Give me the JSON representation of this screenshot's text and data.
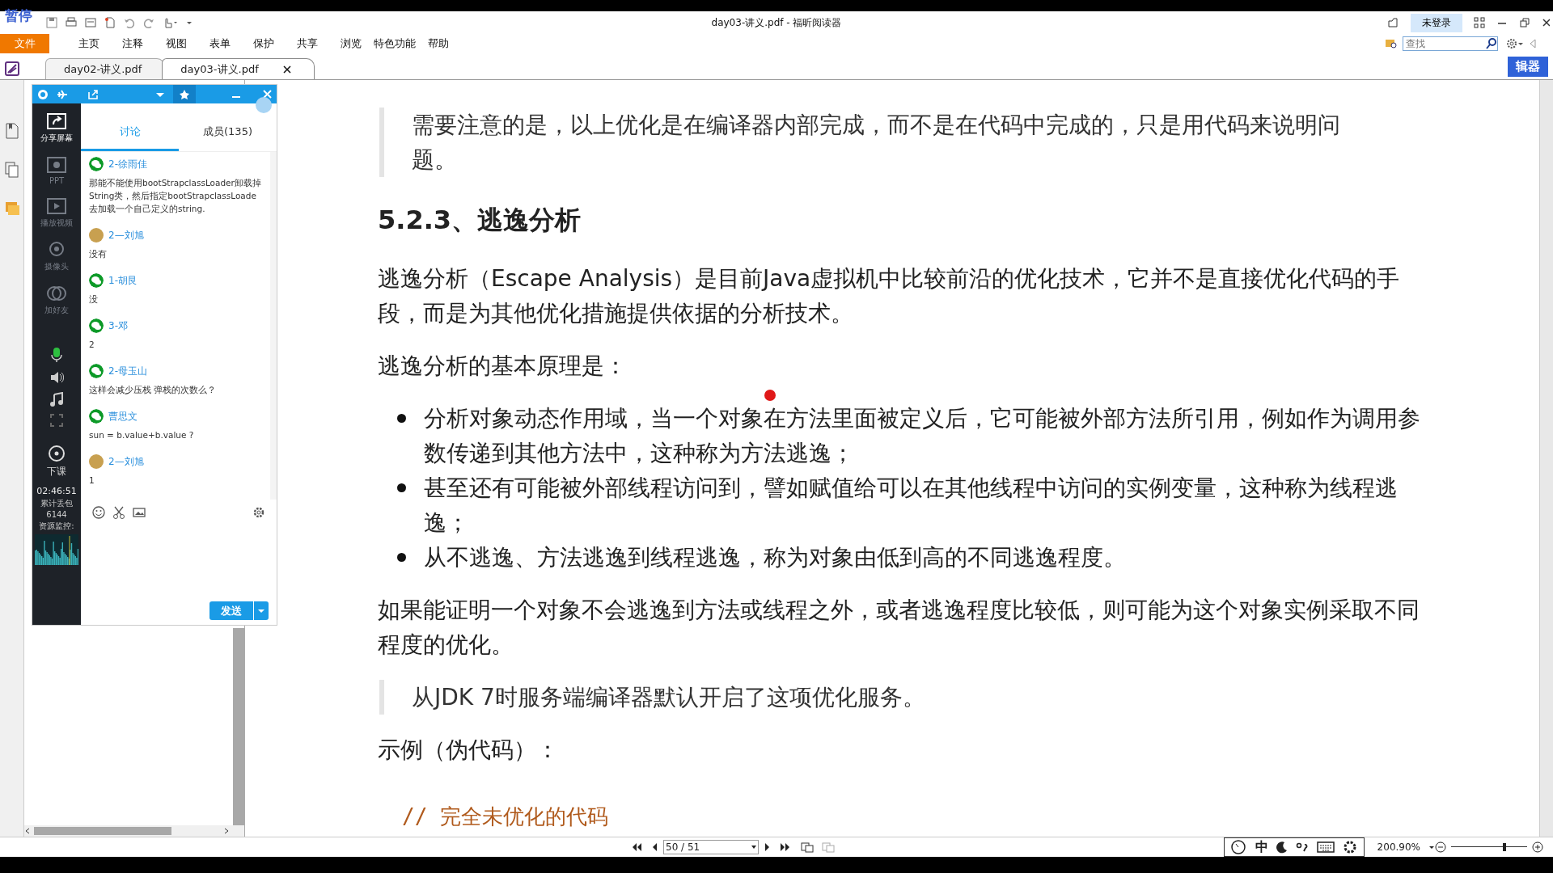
{
  "title_bar": {
    "recorder_status": "暂停",
    "title": "day03-讲义.pdf - 福昕阅读器",
    "login": "未登录"
  },
  "menu": [
    {
      "label": "文件",
      "selected": true
    },
    {
      "label": "主页",
      "selected": false
    },
    {
      "label": "注释",
      "selected": false
    },
    {
      "label": "视图",
      "selected": false
    },
    {
      "label": "表单",
      "selected": false
    },
    {
      "label": "保护",
      "selected": false
    },
    {
      "label": "共享",
      "selected": false
    },
    {
      "label": "浏览",
      "selected": false
    },
    {
      "label": "特色功能",
      "selected": false
    },
    {
      "label": "帮助",
      "selected": false
    }
  ],
  "search": {
    "placeholder": "查找"
  },
  "editor_button": "辑器",
  "doc_tabs": [
    {
      "label": "day02-讲义.pdf",
      "selected": false
    },
    {
      "label": "day03-讲义.pdf",
      "selected": true
    }
  ],
  "class_panel": {
    "tools": [
      {
        "label": "分享屏幕",
        "kind": "share",
        "disabled": false
      },
      {
        "label": "PPT",
        "kind": "ppt",
        "disabled": true
      },
      {
        "label": "播放视频",
        "kind": "video",
        "disabled": true
      },
      {
        "label": "摄像头",
        "kind": "camera",
        "disabled": true
      },
      {
        "label": "加好友",
        "kind": "friend",
        "disabled": true
      }
    ],
    "microphone_on": true,
    "end_class": "下课",
    "timer": "02:46:51",
    "packet_loss_label": "累计丢包",
    "packet_loss": "6144",
    "monitor_label": "资源监控:",
    "tabs": [
      {
        "label": "讨论",
        "selected": true
      },
      {
        "label": "成员(135)",
        "selected": false
      }
    ],
    "messages": [
      {
        "name": "2-徐雨佳",
        "kind": "wechat",
        "text": "那能不能使用bootStrapclassLoader卸载掉String类，然后指定bootStrapclassLoade去加载一个自己定义的string."
      },
      {
        "name": "2—刘旭",
        "kind": "photo",
        "text": "没有"
      },
      {
        "name": "1-胡艮",
        "kind": "wechat",
        "text": "没"
      },
      {
        "name": "3-邓",
        "kind": "wechat",
        "text": "2"
      },
      {
        "name": "2-母玉山",
        "kind": "wechat",
        "text": "这样会减少压栈 弹栈的次数么？"
      },
      {
        "name": "曹思文",
        "kind": "wechat",
        "text": "sun = b.value+b.value ?"
      },
      {
        "name": "2—刘旭",
        "kind": "photo",
        "text": "1"
      }
    ],
    "send": "发送"
  },
  "document": {
    "blocks": [
      {
        "kind": "quote",
        "text": "需要注意的是，以上优化是在编译器内部完成，而不是在代码中完成的，只是用代码来说明问题。"
      },
      {
        "kind": "heading",
        "text": "5.2.3、逃逸分析"
      },
      {
        "kind": "paragraph",
        "text": "逃逸分析（Escape Analysis）是目前Java虚拟机中比较前沿的优化技术，它并不是直接优化代码的手段，而是为其他优化措施提供依据的分析技术。"
      },
      {
        "kind": "paragraph",
        "text": "逃逸分析的基本原理是："
      },
      {
        "kind": "bullets",
        "items": [
          "分析对象动态作用域，当一个对象在方法里面被定义后，它可能被外部方法所引用，例如作为调用参数传递到其他方法中，这种称为方法逃逸；",
          "甚至还有可能被外部线程访问到，譬如赋值给可以在其他线程中访问的实例变量，这种称为线程逃逸；",
          "从不逃逸、方法逃逸到线程逃逸，称为对象由低到高的不同逃逸程度。"
        ]
      },
      {
        "kind": "paragraph",
        "text": "如果能证明一个对象不会逃逸到方法或线程之外，或者逃逸程度比较低，则可能为这个对象实例采取不同程度的优化。"
      },
      {
        "kind": "quote",
        "text": "从JDK 7时服务端编译器默认开启了这项优化服务。"
      },
      {
        "kind": "paragraph",
        "text": "示例（伪代码）："
      },
      {
        "kind": "code",
        "text": "//  完全未优化的代码"
      }
    ]
  },
  "status_bar": {
    "page": "50 / 51",
    "ime": "中",
    "zoom": "200.90%",
    "zoom_slider": {
      "level": 0.7
    }
  }
}
